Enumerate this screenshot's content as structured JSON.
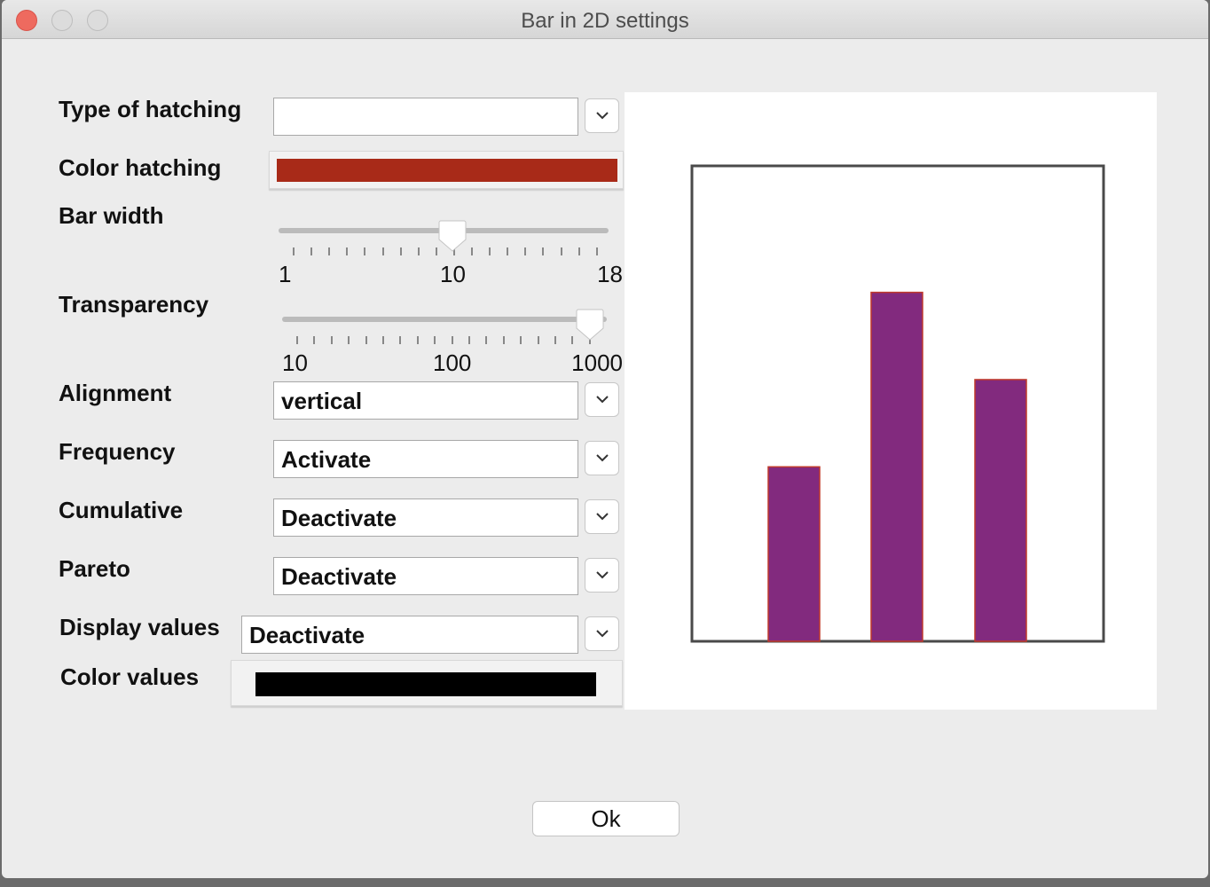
{
  "window": {
    "title": "Bar in 2D settings"
  },
  "labels": {
    "hatching_type": "Type of hatching",
    "color_hatching": "Color hatching",
    "bar_width": "Bar width",
    "transparency": "Transparency",
    "alignment": "Alignment",
    "frequency": "Frequency",
    "cumulative": "Cumulative",
    "pareto": "Pareto",
    "display_values": "Display values",
    "color_values": "Color values"
  },
  "fields": {
    "hatching_type": "",
    "alignment": "vertical",
    "frequency": "Activate",
    "cumulative": "Deactivate",
    "pareto": "Deactivate",
    "display_values": "Deactivate"
  },
  "colors": {
    "hatching": "#a82a18",
    "values": "#000000",
    "bar_fill": "#822a7e",
    "bar_edge": "#c0392b"
  },
  "bar_width_slider": {
    "min_label": "1",
    "mid_label": "10",
    "max_label": "18",
    "value": 10
  },
  "transparency_slider": {
    "min_label": "10",
    "mid_label": "100",
    "max_label": "1000",
    "value": 1000
  },
  "chart_data": {
    "type": "bar",
    "values": [
      2,
      4,
      3
    ],
    "ylim": [
      0,
      5.45
    ],
    "grid": false
  },
  "buttons": {
    "ok": "Ok"
  }
}
